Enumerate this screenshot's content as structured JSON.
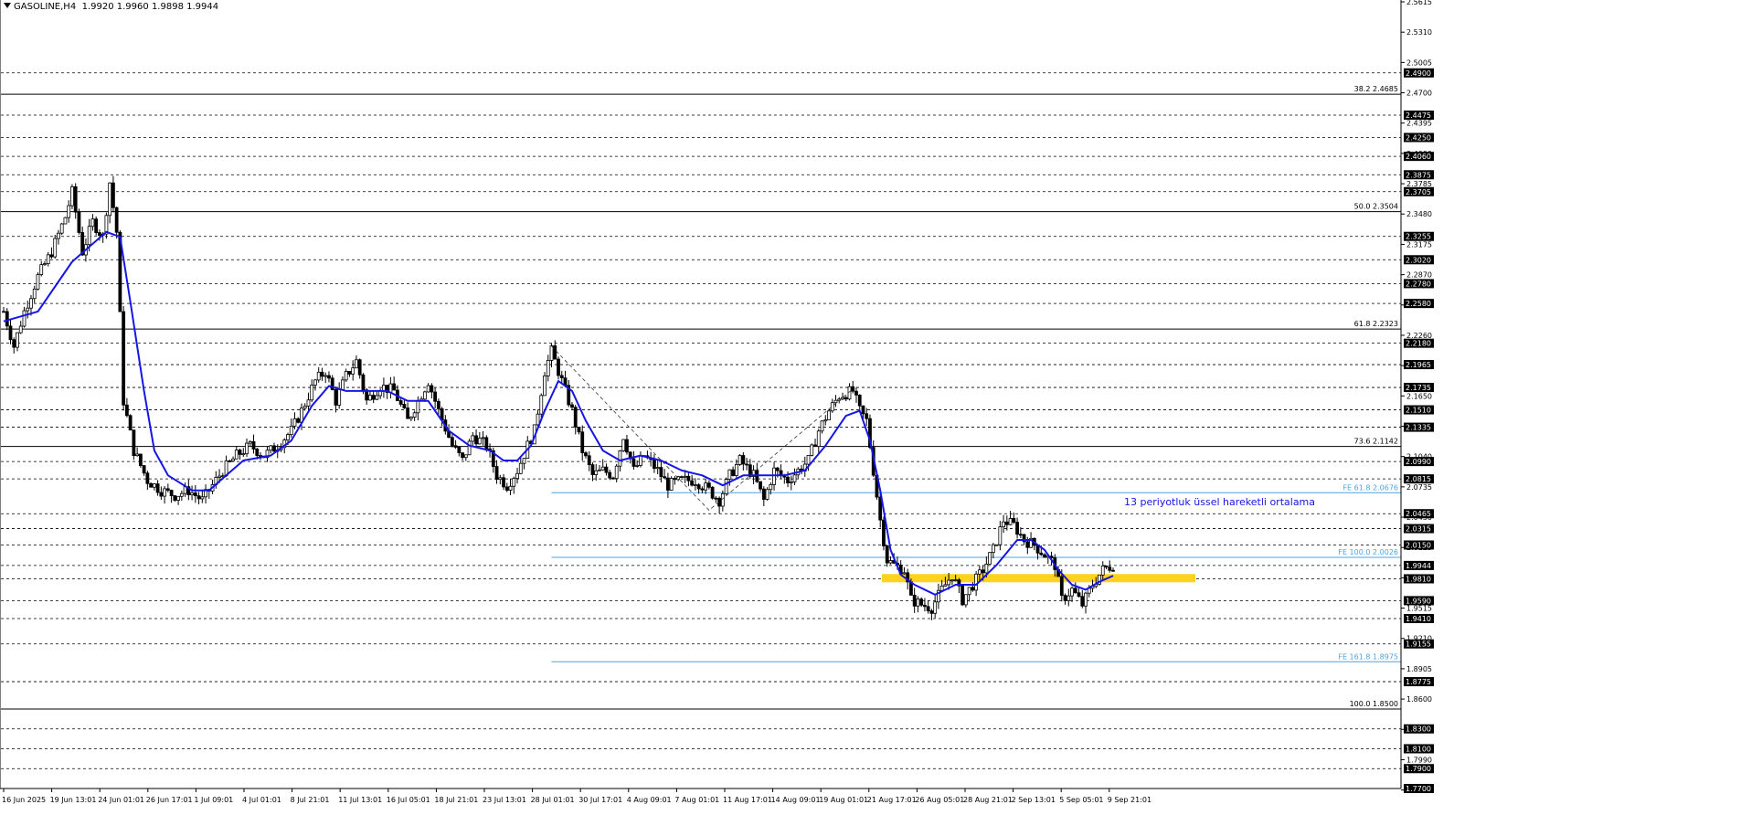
{
  "chart_data": {
    "type": "candlestick",
    "symbol": "GASOLINE,H4",
    "ohlc": [
      "1.9920",
      "1.9960",
      "1.9898",
      "1.9944"
    ],
    "ylim": [
      1.77,
      2.5615
    ],
    "x_tick_labels": [
      "16 Jun 2025",
      "19 Jun 13:01",
      "24 Jun 01:01",
      "26 Jun 17:01",
      "1 Jul 09:01",
      "4 Jul 01:01",
      "8 Jul 21:01",
      "11 Jul 13:01",
      "16 Jul 05:01",
      "18 Jul 21:01",
      "23 Jul 13:01",
      "28 Jul 01:01",
      "30 Jul 17:01",
      "4 Aug 09:01",
      "7 Aug 01:01",
      "11 Aug 17:01",
      "14 Aug 09:01",
      "19 Aug 01:01",
      "21 Aug 17:01",
      "26 Aug 05:01",
      "28 Aug 21:01",
      "2 Sep 13:01",
      "5 Sep 05:01",
      "9 Sep 21:01"
    ],
    "y_tick_labels": [
      2.5615,
      2.531,
      2.5005,
      2.47,
      2.4395,
      2.409,
      2.3785,
      2.348,
      2.3175,
      2.287,
      2.2565,
      2.226,
      2.1955,
      2.165,
      2.1345,
      2.104,
      2.0735,
      2.043,
      2.0125,
      1.982,
      1.9515,
      1.921,
      1.8905,
      1.86,
      1.8295,
      1.799,
      1.7685
    ],
    "dashed_levels": [
      2.49,
      2.4475,
      2.425,
      2.406,
      2.3875,
      2.3705,
      2.3255,
      2.302,
      2.278,
      2.258,
      2.218,
      2.1965,
      2.1735,
      2.151,
      2.1335,
      2.099,
      2.0815,
      2.0465,
      2.0315,
      2.015,
      1.9944,
      1.981,
      1.959,
      1.941,
      1.9155,
      1.8775,
      1.83,
      1.81,
      1.79,
      1.77
    ],
    "fib_levels": [
      {
        "label": "38.2 2.4685",
        "value": 2.4685
      },
      {
        "label": "50.0 2.3504",
        "value": 2.3504
      },
      {
        "label": "61.8 2.2323",
        "value": 2.2323
      },
      {
        "label": "73.6 2.1142",
        "value": 2.1142
      },
      {
        "label": "100.0 1.8500",
        "value": 1.85
      }
    ],
    "fe_levels": [
      {
        "label": "FE 61.8 2.0676",
        "value": 2.0676
      },
      {
        "label": "FE 100.0 2.0026",
        "value": 2.0026
      },
      {
        "label": "FE 161.8 1.8975",
        "value": 1.8975
      }
    ],
    "support_zone": [
      1.9775,
      1.9858
    ],
    "annotation": "13 periyotluk üssel hareketli ortalama",
    "ema_period": 13,
    "anchors": [
      [
        0,
        2.25
      ],
      [
        3,
        2.215
      ],
      [
        6,
        2.25
      ],
      [
        10,
        2.285
      ],
      [
        14,
        2.31
      ],
      [
        18,
        2.345
      ],
      [
        20,
        2.37
      ],
      [
        23,
        2.31
      ],
      [
        26,
        2.34
      ],
      [
        29,
        2.325
      ],
      [
        31,
        2.38
      ],
      [
        33,
        2.33
      ],
      [
        35,
        2.16
      ],
      [
        38,
        2.11
      ],
      [
        42,
        2.08
      ],
      [
        46,
        2.07
      ],
      [
        50,
        2.065
      ],
      [
        54,
        2.07
      ],
      [
        58,
        2.06
      ],
      [
        61,
        2.075
      ],
      [
        64,
        2.09
      ],
      [
        68,
        2.105
      ],
      [
        72,
        2.115
      ],
      [
        76,
        2.105
      ],
      [
        80,
        2.115
      ],
      [
        84,
        2.13
      ],
      [
        87,
        2.15
      ],
      [
        91,
        2.18
      ],
      [
        94,
        2.19
      ],
      [
        97,
        2.16
      ],
      [
        100,
        2.185
      ],
      [
        103,
        2.2
      ],
      [
        106,
        2.16
      ],
      [
        110,
        2.175
      ],
      [
        114,
        2.17
      ],
      [
        118,
        2.14
      ],
      [
        121,
        2.16
      ],
      [
        124,
        2.18
      ],
      [
        127,
        2.15
      ],
      [
        131,
        2.115
      ],
      [
        134,
        2.1
      ],
      [
        137,
        2.125
      ],
      [
        141,
        2.115
      ],
      [
        144,
        2.085
      ],
      [
        147,
        2.075
      ],
      [
        150,
        2.09
      ],
      [
        153,
        2.115
      ],
      [
        155,
        2.13
      ],
      [
        158,
        2.19
      ],
      [
        160,
        2.21
      ],
      [
        163,
        2.18
      ],
      [
        166,
        2.15
      ],
      [
        169,
        2.11
      ],
      [
        172,
        2.085
      ],
      [
        175,
        2.09
      ],
      [
        178,
        2.085
      ],
      [
        181,
        2.125
      ],
      [
        184,
        2.09
      ],
      [
        187,
        2.105
      ],
      [
        191,
        2.09
      ],
      [
        194,
        2.075
      ],
      [
        198,
        2.08
      ],
      [
        202,
        2.08
      ],
      [
        206,
        2.07
      ],
      [
        209,
        2.06
      ],
      [
        212,
        2.085
      ],
      [
        215,
        2.1
      ],
      [
        219,
        2.085
      ],
      [
        222,
        2.06
      ],
      [
        225,
        2.09
      ],
      [
        229,
        2.08
      ],
      [
        232,
        2.09
      ],
      [
        235,
        2.1
      ],
      [
        238,
        2.13
      ],
      [
        241,
        2.15
      ],
      [
        244,
        2.165
      ],
      [
        248,
        2.17
      ],
      [
        250,
        2.15
      ],
      [
        252,
        2.14
      ],
      [
        254,
        2.09
      ],
      [
        256,
        2.04
      ],
      [
        258,
        2.0
      ],
      [
        260,
        1.995
      ],
      [
        263,
        1.99
      ],
      [
        265,
        1.96
      ],
      [
        268,
        1.955
      ],
      [
        271,
        1.952
      ],
      [
        274,
        1.97
      ],
      [
        277,
        1.985
      ],
      [
        280,
        1.96
      ],
      [
        283,
        1.975
      ],
      [
        286,
        1.99
      ],
      [
        289,
        2.01
      ],
      [
        292,
        2.04
      ],
      [
        295,
        2.035
      ],
      [
        298,
        2.02
      ],
      [
        301,
        2.015
      ],
      [
        304,
        2.005
      ],
      [
        307,
        1.995
      ],
      [
        309,
        1.96
      ],
      [
        312,
        1.97
      ],
      [
        315,
        1.955
      ],
      [
        318,
        1.975
      ],
      [
        321,
        1.99
      ],
      [
        324,
        1.995
      ]
    ],
    "ema_curve": [
      [
        0,
        2.24
      ],
      [
        10,
        2.25
      ],
      [
        20,
        2.3
      ],
      [
        30,
        2.33
      ],
      [
        34,
        2.325
      ],
      [
        37,
        2.26
      ],
      [
        41,
        2.17
      ],
      [
        44,
        2.11
      ],
      [
        48,
        2.085
      ],
      [
        55,
        2.07
      ],
      [
        60,
        2.07
      ],
      [
        65,
        2.085
      ],
      [
        70,
        2.1
      ],
      [
        78,
        2.105
      ],
      [
        84,
        2.12
      ],
      [
        90,
        2.155
      ],
      [
        95,
        2.175
      ],
      [
        100,
        2.17
      ],
      [
        106,
        2.17
      ],
      [
        112,
        2.17
      ],
      [
        118,
        2.16
      ],
      [
        124,
        2.16
      ],
      [
        130,
        2.13
      ],
      [
        136,
        2.115
      ],
      [
        142,
        2.11
      ],
      [
        146,
        2.1
      ],
      [
        150,
        2.1
      ],
      [
        154,
        2.115
      ],
      [
        158,
        2.15
      ],
      [
        162,
        2.18
      ],
      [
        166,
        2.17
      ],
      [
        170,
        2.14
      ],
      [
        175,
        2.11
      ],
      [
        180,
        2.1
      ],
      [
        186,
        2.105
      ],
      [
        192,
        2.1
      ],
      [
        198,
        2.09
      ],
      [
        204,
        2.085
      ],
      [
        210,
        2.075
      ],
      [
        216,
        2.085
      ],
      [
        222,
        2.085
      ],
      [
        228,
        2.085
      ],
      [
        234,
        2.09
      ],
      [
        240,
        2.115
      ],
      [
        246,
        2.145
      ],
      [
        250,
        2.15
      ],
      [
        253,
        2.12
      ],
      [
        256,
        2.07
      ],
      [
        259,
        2.01
      ],
      [
        262,
        1.985
      ],
      [
        266,
        1.975
      ],
      [
        272,
        1.965
      ],
      [
        278,
        1.975
      ],
      [
        284,
        1.975
      ],
      [
        290,
        1.995
      ],
      [
        296,
        2.02
      ],
      [
        300,
        2.02
      ],
      [
        304,
        2.01
      ],
      [
        308,
        1.99
      ],
      [
        312,
        1.975
      ],
      [
        316,
        1.97
      ],
      [
        320,
        1.978
      ],
      [
        324,
        1.984
      ]
    ],
    "dashed_zigzag": [
      [
        160,
        2.215
      ],
      [
        206,
        2.05
      ],
      [
        248,
        2.172
      ]
    ],
    "fe_line_start_index": 160,
    "fib_line_end_label": "",
    "total_bars": 325
  }
}
